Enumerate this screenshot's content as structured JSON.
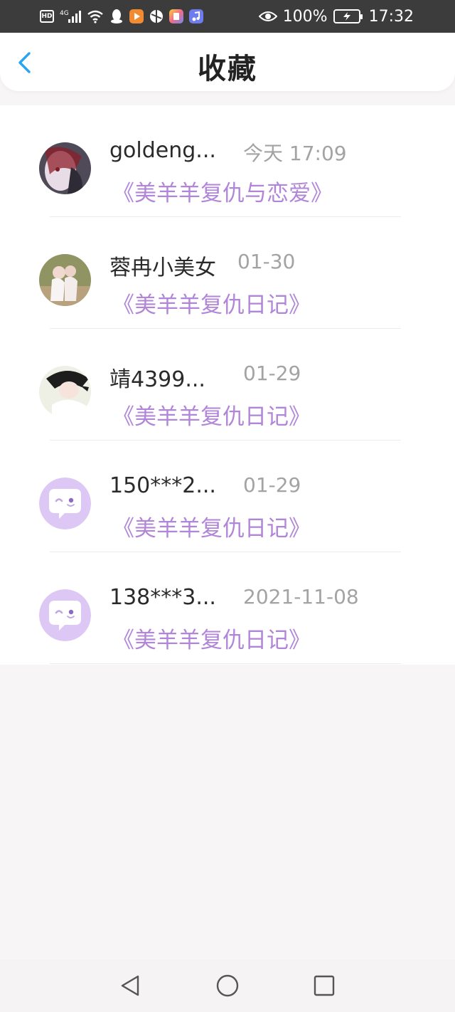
{
  "status_bar": {
    "network": "4G",
    "battery": "100%",
    "time": "17:32"
  },
  "header": {
    "title": "收藏"
  },
  "favorites": [
    {
      "name": "goldeng...",
      "time": "今天 17:09",
      "book": "《美羊羊复仇与恋爱》",
      "avatar": "photo"
    },
    {
      "name": "蓉冉小美女",
      "time": "01-30",
      "book": "《美羊羊复仇日记》",
      "avatar": "photo"
    },
    {
      "name": "靖4399...",
      "time": "01-29",
      "book": "《美羊羊复仇日记》",
      "avatar": "photo"
    },
    {
      "name": "150***2...",
      "time": "01-29",
      "book": "《美羊羊复仇日记》",
      "avatar": "default-chat-avatar"
    },
    {
      "name": "138***3...",
      "time": "2021-11-08",
      "book": "《美羊羊复仇日记》",
      "avatar": "default-chat-avatar"
    }
  ],
  "colors": {
    "accent": "#b185d8",
    "back_arrow": "#2aa3f0",
    "avatar_default_bg": "#dcc7f5"
  }
}
